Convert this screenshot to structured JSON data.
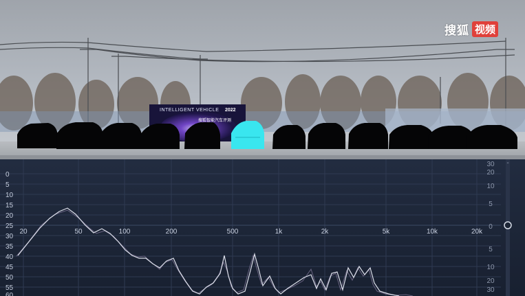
{
  "watermark": {
    "brand": "搜狐",
    "badge": "视频"
  },
  "banner": {
    "title": "INTELLIGENT VEHICLE",
    "year": "2022",
    "subtitle": "搜狐智能汽车评测"
  },
  "analyzer": {
    "db_axis_left": [
      "0",
      "5",
      "10",
      "15",
      "20",
      "25",
      "30",
      "35",
      "40",
      "45",
      "50",
      "55",
      "60"
    ],
    "db_axis_right": [
      "30",
      "20",
      "10",
      "5",
      "0",
      "5",
      "10",
      "20",
      "30"
    ],
    "freq_labels": [
      "20",
      "50",
      "100",
      "200",
      "500",
      "1k",
      "2k",
      "5k",
      "10k",
      "20k"
    ],
    "gain_knob_value": "0"
  }
}
